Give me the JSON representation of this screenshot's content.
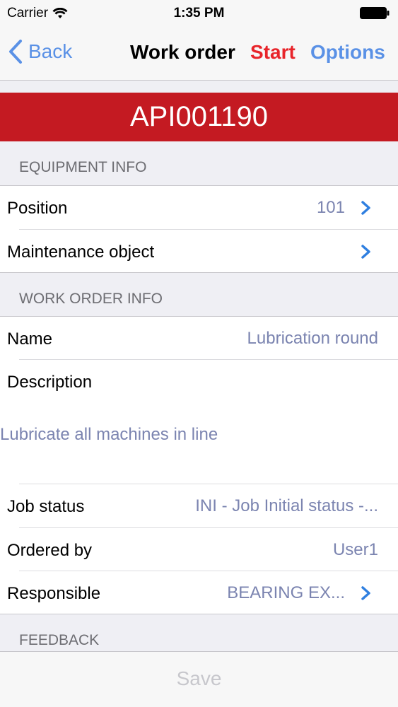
{
  "status_bar": {
    "carrier": "Carrier",
    "time": "1:35 PM"
  },
  "nav": {
    "back_label": "Back",
    "title": "Work order",
    "start_label": "Start",
    "options_label": "Options"
  },
  "banner": {
    "text": "API001190",
    "color": "#c41a22"
  },
  "sections": {
    "equipment_info": "EQUIPMENT INFO",
    "work_order_info": "WORK ORDER INFO",
    "feedback": "FEEDBACK"
  },
  "equipment": {
    "position_label": "Position",
    "position_value": "101",
    "maintenance_object_label": "Maintenance object"
  },
  "work_order": {
    "name_label": "Name",
    "name_value": "Lubrication round",
    "description_label": "Description",
    "description_value": "Lubricate all machines in line",
    "job_status_label": "Job status",
    "job_status_value": "INI - Job Initial status -...",
    "ordered_by_label": "Ordered by",
    "ordered_by_value": "User1",
    "responsible_label": "Responsible",
    "responsible_value": "BEARING EX..."
  },
  "footer": {
    "save_label": "Save"
  },
  "colors": {
    "accent": "#5a91e6",
    "start": "#e8242a",
    "value_text": "#7b84b0"
  }
}
